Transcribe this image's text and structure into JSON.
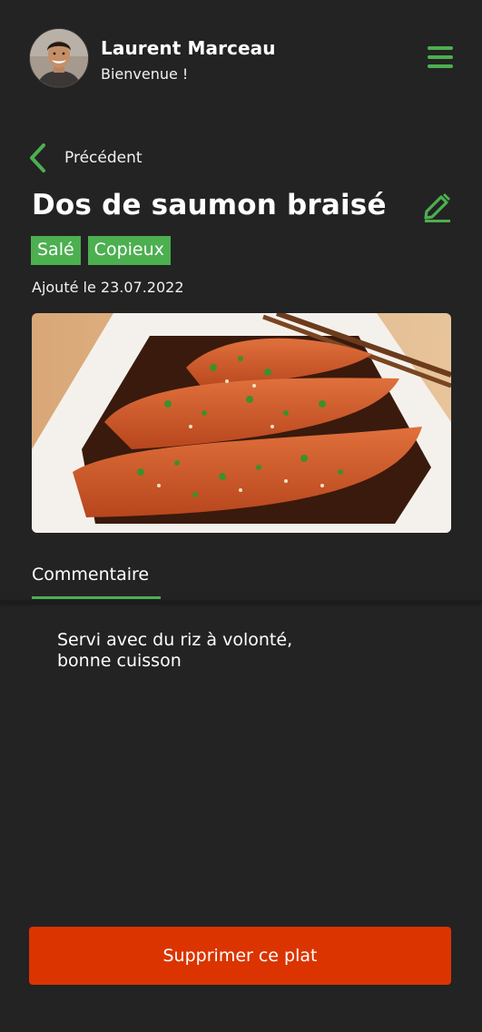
{
  "user": {
    "name": "Laurent Marceau",
    "greeting": "Bienvenue !"
  },
  "nav": {
    "back_label": "Précédent",
    "menu_icon": "hamburger-menu-icon"
  },
  "dish": {
    "title": "Dos de saumon braisé",
    "tags": [
      "Salé",
      "Copieux"
    ],
    "added_date": "Ajouté le 23.07.2022"
  },
  "tabs": {
    "active": "Commentaire"
  },
  "comment": {
    "line1": "Servi avec du riz à volonté,",
    "line2": "bonne cuisson"
  },
  "actions": {
    "delete_label": "Supprimer ce plat"
  },
  "colors": {
    "accent": "#4caf50",
    "danger": "#db3400",
    "background": "#232323"
  }
}
